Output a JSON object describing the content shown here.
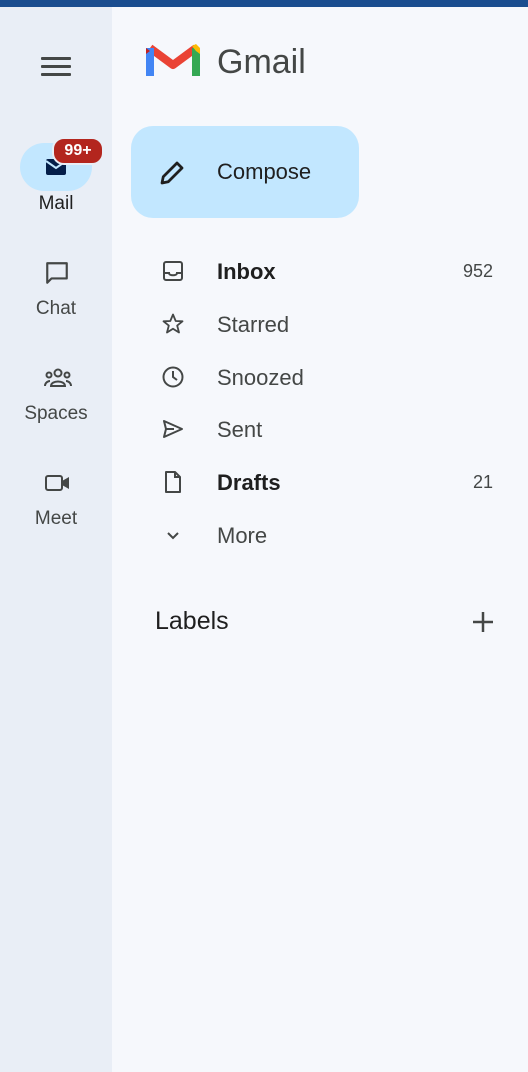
{
  "app": {
    "name": "Gmail"
  },
  "rail": {
    "items": [
      {
        "label": "Mail",
        "icon": "mail-icon",
        "badge": "99+",
        "active": true
      },
      {
        "label": "Chat",
        "icon": "chat-icon"
      },
      {
        "label": "Spaces",
        "icon": "spaces-icon"
      },
      {
        "label": "Meet",
        "icon": "meet-icon"
      }
    ]
  },
  "compose": {
    "label": "Compose",
    "icon": "pencil-icon"
  },
  "nav": {
    "items": [
      {
        "label": "Inbox",
        "icon": "inbox-icon",
        "count": "952",
        "bold": true
      },
      {
        "label": "Starred",
        "icon": "star-icon"
      },
      {
        "label": "Snoozed",
        "icon": "clock-icon"
      },
      {
        "label": "Sent",
        "icon": "send-icon"
      },
      {
        "label": "Drafts",
        "icon": "draft-icon",
        "count": "21",
        "bold": true
      },
      {
        "label": "More",
        "icon": "chevron-down-icon"
      }
    ]
  },
  "labels": {
    "heading": "Labels",
    "add_icon": "plus-icon"
  },
  "colors": {
    "rail_bg": "#e9eef6",
    "page_bg": "#f6f8fc",
    "compose_bg": "#c2e7ff",
    "badge_bg": "#b3261e",
    "topbar": "#1a4d8f"
  }
}
